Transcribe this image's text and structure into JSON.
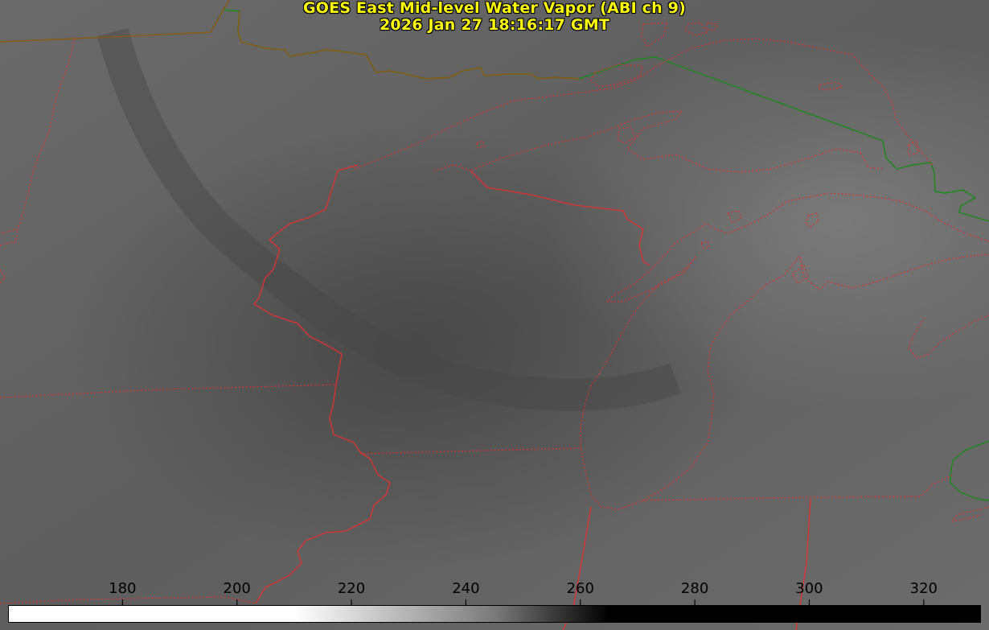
{
  "title": {
    "line1": "GOES East Mid-level Water Vapor (ABI ch 9)",
    "line2": "2026 Jan 27 18:16:17 GMT"
  },
  "colorbar": {
    "ticks": [
      "180",
      "200",
      "220",
      "240",
      "260",
      "280",
      "300",
      "320"
    ],
    "range": [
      160,
      330
    ],
    "gradient_stops": [
      {
        "value": 160,
        "color": "#ffffff"
      },
      {
        "value": 210,
        "color": "#ffffff"
      },
      {
        "value": 245,
        "color": "#7a7a7a"
      },
      {
        "value": 265,
        "color": "#000000"
      },
      {
        "value": 330,
        "color": "#000000"
      }
    ]
  },
  "map": {
    "background_color": "#6e6e6e",
    "state_border_color": "#e03030",
    "international_border_color": "#1a8a1a",
    "overlap_border_color": "#8a5a10"
  }
}
